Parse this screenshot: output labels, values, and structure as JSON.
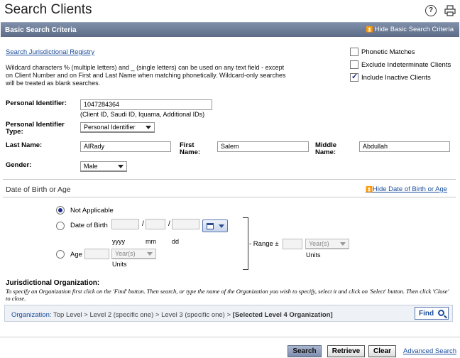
{
  "page": {
    "title": "Search Clients",
    "help_icon": "help-icon",
    "print_icon": "print-icon"
  },
  "basic": {
    "section_title": "Basic Search Criteria",
    "hide_label": "Hide Basic Search Criteria",
    "registry_link": "Search Jurisdictional Registry",
    "help_text": "Wildcard characters % (multiple letters) and _ (single letters) can be used on any text field - except on Client Number and on First and Last Name when matching phonetically. Wildcard-only searches will be treated as blank searches.",
    "options": [
      {
        "label": "Phonetic Matches",
        "checked": false
      },
      {
        "label": "Exclude Indeterminate Clients",
        "checked": false
      },
      {
        "label": "Include Inactive Clients",
        "checked": true
      }
    ],
    "personal_identifier": {
      "label": "Personal Identifier:",
      "value": "1047284364",
      "hint": "(Client ID, Saudi ID, Iquama, Additional IDs)"
    },
    "identifier_type": {
      "label": "Personal Identifier Type:",
      "value": "Personal Identifier"
    },
    "last_name": {
      "label": "Last Name:",
      "value": "AlRady"
    },
    "first_name": {
      "label": "First Name:",
      "value": "Salem"
    },
    "middle_name": {
      "label": "Middle Name:",
      "value": "Abdullah"
    },
    "gender": {
      "label": "Gender:",
      "value": "Male"
    }
  },
  "dob": {
    "section_title": "Date of Birth or Age",
    "hide_label": "Hide Date of Birth or Age",
    "not_applicable": "Not Applicable",
    "date_of_birth": "Date of Birth",
    "separator": "/",
    "yyyy": "yyyy",
    "mm": "mm",
    "dd": "dd",
    "age": "Age",
    "units_select": "Year(s)",
    "units": "Units",
    "range_label": "- Range ±",
    "range_units_select": "Year(s)",
    "range_units": "Units",
    "selected": "not_applicable"
  },
  "jurisdiction": {
    "title": "Jurisdictional Organization:",
    "description": "To specify an Organization first click on the 'Find' button. Then search, or type the name of the Organization you wish to specify, select it and click on 'Select' button. Then click 'Close' to close.",
    "org_label": "Organization:",
    "org_path": "Top Level > Level 2 (specific one) > Level 3 (specific one) >",
    "org_selected": "[Selected Level 4 Organization]",
    "find_label": "Find"
  },
  "footer": {
    "search": "Search",
    "retrieve": "Retrieve",
    "clear": "Clear",
    "advanced": "Advanced Search"
  }
}
